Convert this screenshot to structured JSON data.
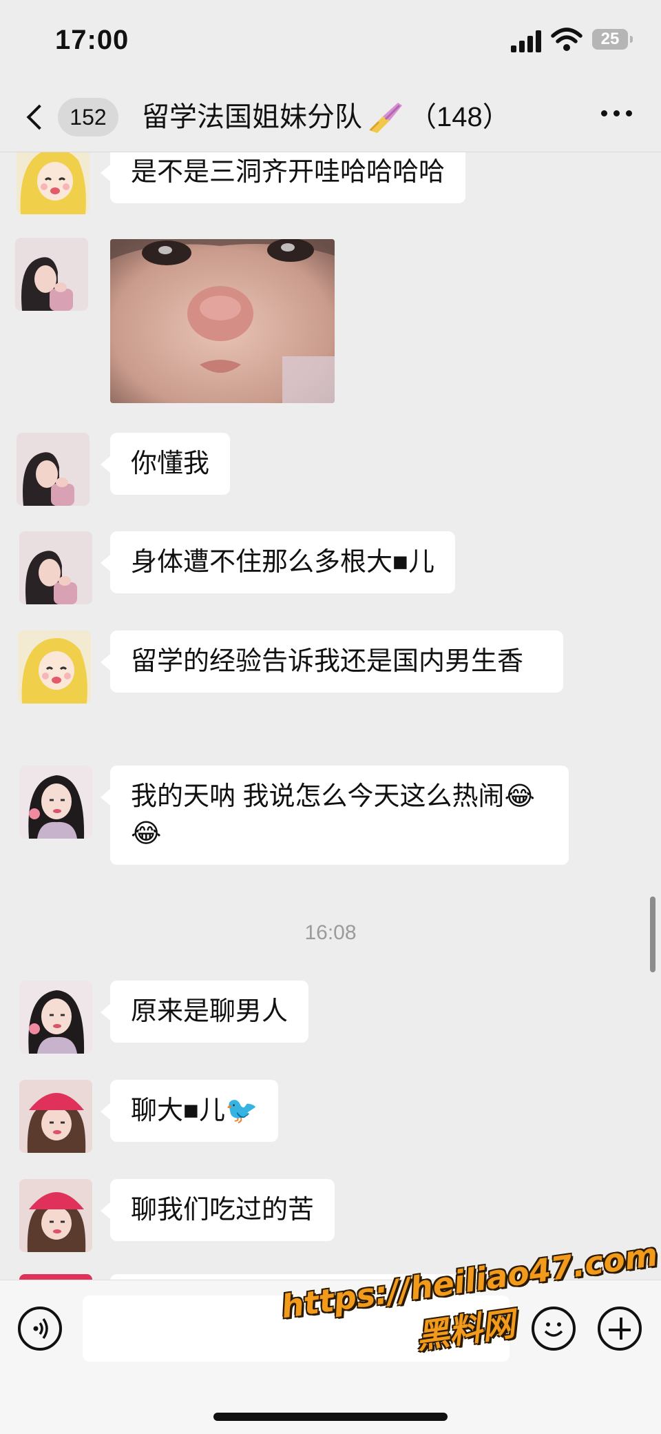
{
  "status_bar": {
    "time": "17:00",
    "battery": "25"
  },
  "nav": {
    "back_badge": "152",
    "group_name": "留学法国姐妹分队",
    "member_count": "（148）"
  },
  "messages": [
    {
      "avatar": "yellow-hair-cartoon",
      "text": "是不是三洞齐开哇哈哈哈哈"
    },
    {
      "avatar": "girl-photo-a",
      "image": "crying-baby-face-photo"
    },
    {
      "avatar": "girl-photo-a",
      "text": "你懂我"
    },
    {
      "avatar": "girl-photo-a",
      "text": "身体遭不住那么多根大■儿"
    },
    {
      "avatar": "yellow-hair-cartoon",
      "text": "留学的经验告诉我还是国内男生香"
    },
    {
      "avatar": "girl-photo-b",
      "text": "我的天呐 我说怎么今天这么热闹😂😂"
    },
    {
      "avatar": "girl-photo-b",
      "text": "原来是聊男人"
    },
    {
      "avatar": "girl-photo-red-hat",
      "text": "聊大■儿🐦"
    },
    {
      "avatar": "girl-photo-red-hat",
      "text": "聊我们吃过的苦"
    }
  ],
  "time_divider": "16:08",
  "input": {
    "placeholder": "",
    "value": ""
  },
  "watermark": {
    "url": "https://heiliao47.com",
    "name": "黑料网"
  },
  "colors": {
    "background": "#ededed",
    "bubble": "#ffffff",
    "watermark": "#f29a1c"
  }
}
